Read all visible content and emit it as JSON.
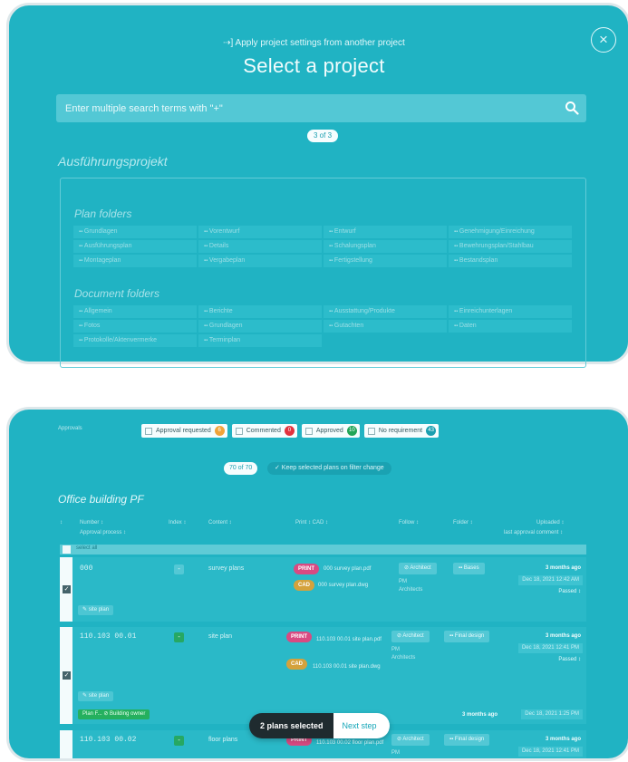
{
  "dialog": {
    "apply_link": "⇢] Apply project settings from another project",
    "title": "Select a project",
    "close_icon": "×",
    "search_placeholder": "Enter multiple search terms with \"+\"",
    "result_count": "3 of 3",
    "project_name": "Ausführungsprojekt",
    "plan_folders_title": "Plan folders",
    "plan_folders": [
      "Grundlagen",
      "Vorentwurf",
      "Entwurf",
      "Genehmigung/Einreichung",
      "Ausführungsplan",
      "Details",
      "Schalungsplan",
      "Bewehrungsplan/Stahlbau",
      "Montageplan",
      "Vergabeplan",
      "Fertigstellung",
      "Bestandsplan"
    ],
    "document_folders_title": "Document folders",
    "document_folders": [
      "Allgemein",
      "Berichte",
      "Ausstattung/Produkte",
      "Einreichunterlagen",
      "Fotos",
      "Grundlagen",
      "Gutachten",
      "Daten",
      "Protokolle/Aktenvermerke",
      "Terminplan"
    ]
  },
  "plans": {
    "approvals_label": "Approvals",
    "filters": [
      {
        "label": "Approval requested",
        "count": "6",
        "color": "#f0a43a"
      },
      {
        "label": "Commented",
        "count": "0",
        "color": "#e2333f"
      },
      {
        "label": "Approved",
        "count": "10",
        "color": "#22a558"
      },
      {
        "label": "No requirement",
        "count": "43",
        "color": "#1b9fb0"
      }
    ],
    "count": "70 of 70",
    "keep_selected": "✓ Keep selected plans on filter change",
    "building": "Office building PF",
    "headers": {
      "number": "Number ↕",
      "approval_process": "Approval process ↕",
      "index": "Index ↕",
      "content": "Content ↕",
      "print_cad": "Print ↕   CAD ↕",
      "follow": "Follow ↕",
      "folder": "Folder ↕",
      "uploaded": "Uploaded ↕",
      "last_approval": "last approval comment ↕"
    },
    "select_all": "select all",
    "rows": [
      {
        "number": "000",
        "index": "-",
        "content": "survey plans",
        "print_tag": "PRINT",
        "print_file": "000 survey plan.pdf",
        "cad_tag": "CAD",
        "cad_file": "000 survey plan.dwg",
        "follow_btn": "⊘ Architect",
        "follow_role": "PM",
        "follow_org": "Architects",
        "folder_btn": "▪▪ Bases",
        "ago": "3 months ago",
        "date": "Dec 18, 2021 12:42 AM",
        "status": "Passed ↕",
        "tag": "✎ site plan"
      },
      {
        "number": "110.103 00.01",
        "index": "-",
        "content": "site plan",
        "print_tag": "PRINT",
        "print_file": "110.103 00.01 site plan.pdf",
        "cad_tag": "CAD",
        "cad_file": "110.103 00.01 site plan.dwg",
        "follow_btn": "⊘ Architect",
        "follow_role": "PM",
        "follow_org": "Architects",
        "folder_btn": "▪▪ Final design",
        "ago": "3 months ago",
        "date": "Dec 18, 2021 12:41 PM",
        "status": "Passed ↕",
        "tag": "✎ site plan",
        "approval_tag": "Plan F... ⊘ Building owner",
        "approval_ago": "3 months ago",
        "approval_date": "Dec 18, 2021 1:25 PM"
      },
      {
        "number": "110.103 00.02",
        "index": "-",
        "content": "floor plans",
        "print_tag": "PRINT",
        "print_file": "110.103 00.02 floor plan.pdf",
        "follow_btn": "⊘ Architect",
        "follow_role": "PM",
        "folder_btn": "▪▪ Final design",
        "ago": "3 months ago",
        "date": "Dec 18, 2021 12:41 PM"
      }
    ],
    "selection": {
      "label": "2 plans selected",
      "next": "Next step"
    }
  }
}
